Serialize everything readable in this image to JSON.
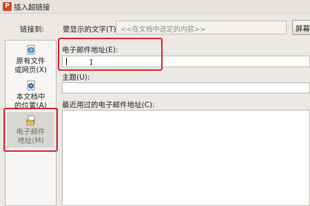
{
  "window": {
    "title": "插入超链接",
    "app_icon": "P"
  },
  "top": {
    "link_to_label": "链接到:",
    "display_text_label": "要显示的文字(T):",
    "display_text_value": "<<在文档中选定的内容>>",
    "screentip_button": "屏幕提"
  },
  "nav": {
    "existing": {
      "line1": "原有文件",
      "line2": "或网页(X)"
    },
    "place": {
      "line1": "本文档中",
      "line2": "的位置(A)"
    },
    "email": {
      "line1": "电子邮件",
      "line2": "地址(M)",
      "selected": true
    }
  },
  "form": {
    "email_address_label": "电子邮件地址(E):",
    "email_address_value": "",
    "cursor_glyph": "I",
    "subject_label": "主题(U):",
    "subject_value": "",
    "recent_label": "最近用过的电子邮件地址(C):"
  },
  "colors": {
    "highlight": "#e01b2a",
    "app_accent": "#d24726"
  }
}
